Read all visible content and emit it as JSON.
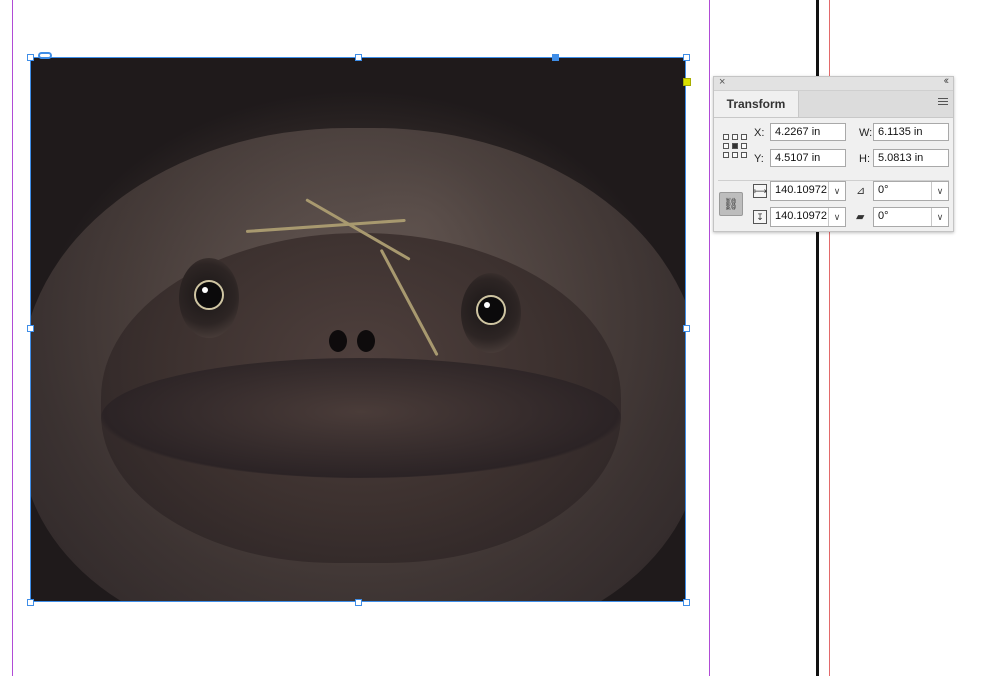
{
  "panel": {
    "title": "Transform",
    "close_icon": "×",
    "collapse_icon": "‹‹",
    "x_label": "X:",
    "x_value": "4.2267 in",
    "y_label": "Y:",
    "y_value": "4.5107 in",
    "w_label": "W:",
    "w_value": "6.1135 in",
    "h_label": "H:",
    "h_value": "5.0813 in",
    "scale_x_value": "140.10972",
    "scale_y_value": "140.10972",
    "rotate_value": "0°",
    "shear_value": "0°",
    "dropdown_arrow": "∨",
    "constrain_icon": "chain-link-icon",
    "scale_x_icon_glyph": "⟼",
    "scale_y_icon_glyph": "↧",
    "rotate_icon_glyph": "⊿",
    "shear_icon_glyph": "▰",
    "constrain_glyph": "⛓"
  },
  "colors": {
    "selection": "#3f8ee8",
    "margin_guide": "#b04bd6",
    "bleed_guide": "#e36a6a",
    "spine": "#111111"
  }
}
